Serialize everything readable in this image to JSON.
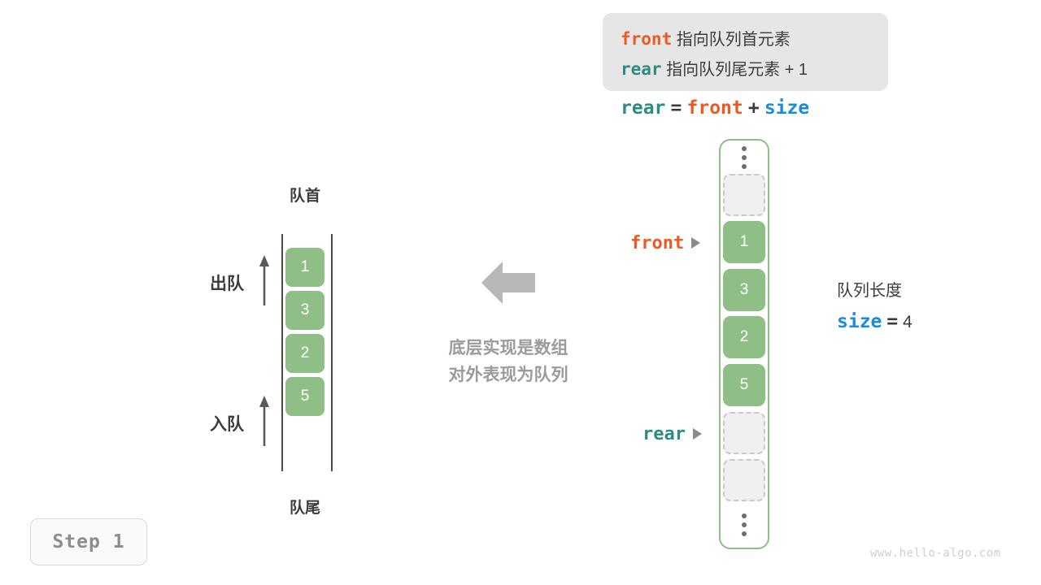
{
  "step_badge": {
    "label": "Step 1"
  },
  "watermark": {
    "text": "www.hello-algo.com"
  },
  "left_queue": {
    "head_label": "队首",
    "tail_label": "队尾",
    "dequeue_label": "出队",
    "enqueue_label": "入队",
    "cells": [
      "1",
      "3",
      "2",
      "5"
    ]
  },
  "center": {
    "note_line_1": "底层实现是数组",
    "note_line_2": "对外表现为队列",
    "arrow_icon": "arrow-left-icon"
  },
  "definition": {
    "line1_code": "front",
    "line1_text": " 指向队列首元素",
    "line2_code": "rear",
    "line2_text": " 指向队列尾元素 + 1",
    "formula": {
      "rear": "rear",
      "eq": "=",
      "front": "front",
      "plus": "+",
      "size": "size"
    }
  },
  "array": {
    "ellipsis_icon": "vertical-ellipsis-icon",
    "cells": [
      {
        "type": "empty",
        "value": ""
      },
      {
        "type": "filled",
        "value": "1"
      },
      {
        "type": "filled",
        "value": "3"
      },
      {
        "type": "filled",
        "value": "2"
      },
      {
        "type": "filled",
        "value": "5"
      },
      {
        "type": "empty",
        "value": ""
      },
      {
        "type": "empty",
        "value": ""
      }
    ],
    "pointers": {
      "front": "front",
      "rear": "rear"
    }
  },
  "size_note": {
    "caption": "队列长度",
    "name": "size",
    "eq": "=",
    "value": "4"
  },
  "colors": {
    "front": "#ec5a24",
    "rear": "#2e8b80",
    "size": "#1a8cd8",
    "cell_green": "#8fbf86",
    "empty_cell": "#f0f0f0",
    "gray_text": "#9b9b9b"
  }
}
